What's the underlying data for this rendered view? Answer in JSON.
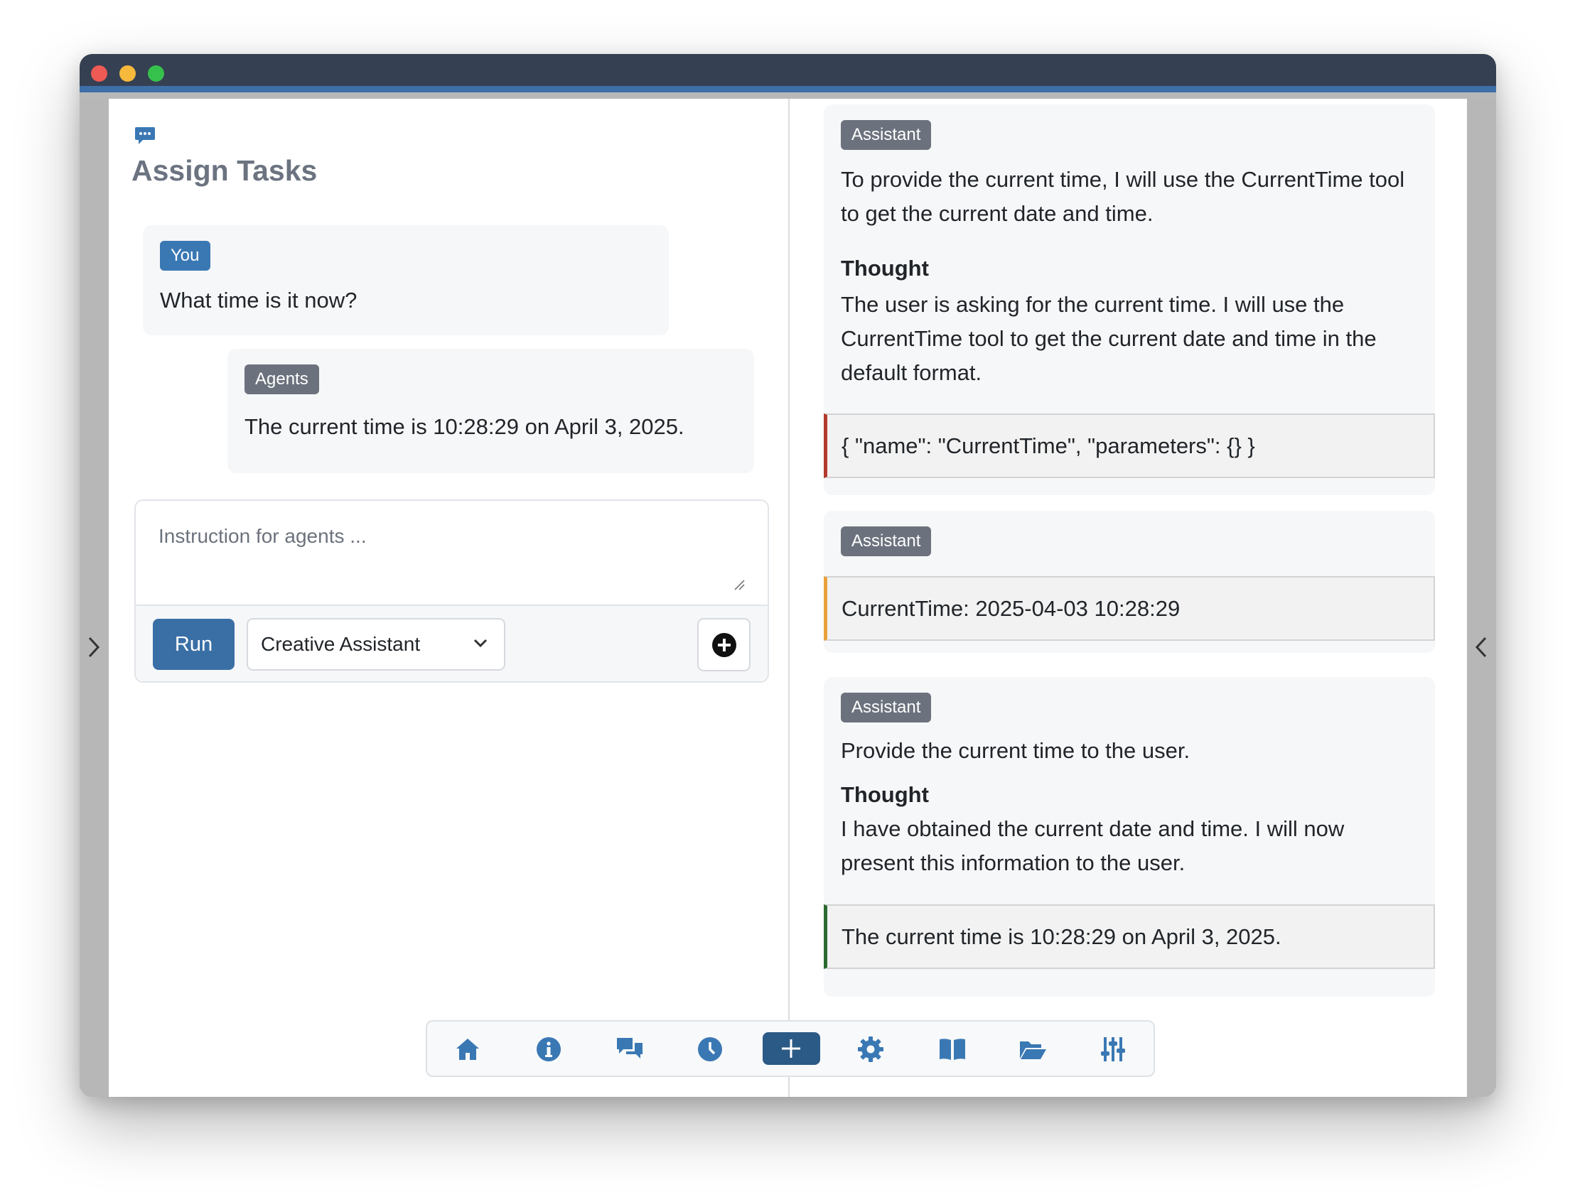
{
  "app": {
    "title": "Assign Tasks"
  },
  "chat": {
    "user_message": {
      "sender": "You",
      "text": "What time is it now?"
    },
    "agents_message": {
      "sender": "Agents",
      "text": "The current time is 10:28:29 on April 3, 2025."
    }
  },
  "composer": {
    "placeholder": "Instruction for agents ...",
    "run_label": "Run",
    "selected_agent": "Creative Assistant"
  },
  "log": {
    "cards": [
      {
        "badge": "Assistant",
        "text": "To provide the current time, I will use the CurrentTime tool to get the current date and time.",
        "thought_label": "Thought",
        "thought": "The user is asking for the current time. I will use the CurrentTime tool to get the current date and time in the default format.",
        "code": "{ \"name\": \"CurrentTime\", \"parameters\": {} }"
      },
      {
        "badge": "Assistant",
        "code": "CurrentTime: 2025-04-03 10:28:29"
      },
      {
        "badge": "Assistant",
        "text": "Provide the current time to the user.",
        "thought_label": "Thought",
        "thought": "I have obtained the current date and time. I will now present this information to the user.",
        "code": "The current time is 10:28:29 on April 3, 2025."
      }
    ]
  },
  "toolbar": {
    "items": [
      "home-icon",
      "info-icon",
      "comments-icon",
      "clock-icon",
      "plus-icon",
      "gear-icon",
      "book-icon",
      "folder-open-icon",
      "sliders-icon"
    ],
    "active": "plus-icon"
  },
  "colors": {
    "accent": "#3a78b4",
    "title_bar": "#354052",
    "active_toolbar": "#2c5a86"
  }
}
